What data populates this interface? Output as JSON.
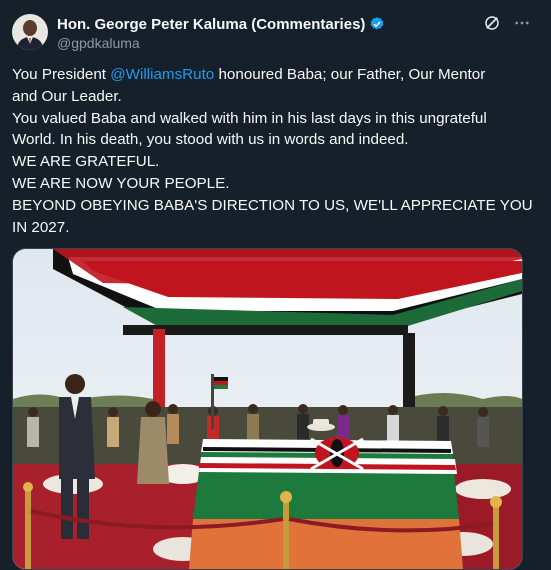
{
  "author": {
    "display_name": "Hon. George Peter Kaluma (Commentaries)",
    "handle": "@gpdkaluma",
    "verified": true
  },
  "icons": {
    "avatar": "profile-photo",
    "verified": "verified-badge-icon",
    "grok": "grok-icon",
    "more": "more-options-icon"
  },
  "tweet": {
    "line1_prefix": "You President ",
    "mention": "@WilliamsRuto",
    "line1_suffix": " honoured Baba; our Father, Our Mentor",
    "line2": "and Our Leader.",
    "line3": "You valued Baba and walked with him in his last days in this ungrateful",
    "line4": "World. In his death, you stood with us in words and indeed.",
    "line5": "WE ARE GRATEFUL.",
    "line6": "WE ARE NOW YOUR PEOPLE.",
    "line7": "BEYOND OBEYING BABA'S DIRECTION TO US, WE'LL APPRECIATE YOU",
    "line8": "IN 2027."
  },
  "media": {
    "description_kind": "photo",
    "flag_colors": [
      "#000000",
      "#bb0a1e",
      "#006b3f",
      "#ffffff"
    ]
  },
  "colors": {
    "background": "#15202b",
    "text": "#f7f9f9",
    "secondary_text": "#8b98a5",
    "accent": "#1d9bf0"
  }
}
